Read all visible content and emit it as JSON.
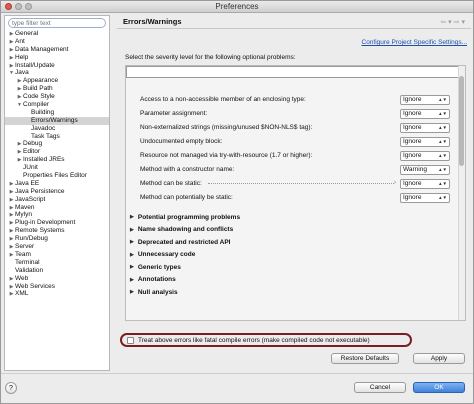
{
  "window": {
    "title": "Preferences"
  },
  "sidebar": {
    "filter_placeholder": "type filter text",
    "items": [
      {
        "label": "General",
        "twisty": "▶",
        "indent": 0
      },
      {
        "label": "Ant",
        "twisty": "▶",
        "indent": 0
      },
      {
        "label": "Data Management",
        "twisty": "▶",
        "indent": 0
      },
      {
        "label": "Help",
        "twisty": "▶",
        "indent": 0
      },
      {
        "label": "Install/Update",
        "twisty": "▶",
        "indent": 0
      },
      {
        "label": "Java",
        "twisty": "▼",
        "indent": 0
      },
      {
        "label": "Appearance",
        "twisty": "▶",
        "indent": 1
      },
      {
        "label": "Build Path",
        "twisty": "▶",
        "indent": 1
      },
      {
        "label": "Code Style",
        "twisty": "▶",
        "indent": 1
      },
      {
        "label": "Compiler",
        "twisty": "▼",
        "indent": 1
      },
      {
        "label": "Building",
        "twisty": "",
        "indent": 2
      },
      {
        "label": "Errors/Warnings",
        "twisty": "",
        "indent": 2,
        "selected": true
      },
      {
        "label": "Javadoc",
        "twisty": "",
        "indent": 2
      },
      {
        "label": "Task Tags",
        "twisty": "",
        "indent": 2
      },
      {
        "label": "Debug",
        "twisty": "▶",
        "indent": 1
      },
      {
        "label": "Editor",
        "twisty": "▶",
        "indent": 1
      },
      {
        "label": "Installed JREs",
        "twisty": "▶",
        "indent": 1
      },
      {
        "label": "JUnit",
        "twisty": "",
        "indent": 1
      },
      {
        "label": "Properties Files Editor",
        "twisty": "",
        "indent": 1
      },
      {
        "label": "Java EE",
        "twisty": "▶",
        "indent": 0
      },
      {
        "label": "Java Persistence",
        "twisty": "▶",
        "indent": 0
      },
      {
        "label": "JavaScript",
        "twisty": "▶",
        "indent": 0
      },
      {
        "label": "Maven",
        "twisty": "▶",
        "indent": 0
      },
      {
        "label": "Mylyn",
        "twisty": "▶",
        "indent": 0
      },
      {
        "label": "Plug-in Development",
        "twisty": "▶",
        "indent": 0
      },
      {
        "label": "Remote Systems",
        "twisty": "▶",
        "indent": 0
      },
      {
        "label": "Run/Debug",
        "twisty": "▶",
        "indent": 0
      },
      {
        "label": "Server",
        "twisty": "▶",
        "indent": 0
      },
      {
        "label": "Team",
        "twisty": "▶",
        "indent": 0
      },
      {
        "label": "Terminal",
        "twisty": "",
        "indent": 0
      },
      {
        "label": "Validation",
        "twisty": "",
        "indent": 0
      },
      {
        "label": "Web",
        "twisty": "▶",
        "indent": 0
      },
      {
        "label": "Web Services",
        "twisty": "▶",
        "indent": 0
      },
      {
        "label": "XML",
        "twisty": "▶",
        "indent": 0
      }
    ]
  },
  "panel": {
    "title": "Errors/Warnings",
    "nav_back": "⇦ ▾",
    "nav_fwd": "⇨ ▾",
    "configure_link": "Configure Project Specific Settings...",
    "description": "Select the severity level for the following optional problems:",
    "options": [
      {
        "label": "Access to a non-accessible member of an enclosing type:",
        "value": "Ignore",
        "dots": false
      },
      {
        "label": "Parameter assignment:",
        "value": "Ignore",
        "dots": false
      },
      {
        "label": "Non-externalized strings (missing/unused $NON-NLS$ tag):",
        "value": "Ignore",
        "dots": false
      },
      {
        "label": "Undocumented empty block:",
        "value": "Ignore",
        "dots": false
      },
      {
        "label": "Resource not managed via try-with-resource (1.7 or higher):",
        "value": "Ignore",
        "dots": false
      },
      {
        "label": "Method with a constructor name:",
        "value": "Warning",
        "dots": false
      },
      {
        "label": "Method can be static:",
        "value": "Ignore",
        "dots": true
      },
      {
        "label": "Method can potentially be static:",
        "value": "Ignore",
        "dots": false
      }
    ],
    "sections": [
      "Potential programming problems",
      "Name shadowing and conflicts",
      "Deprecated and restricted API",
      "Unnecessary code",
      "Generic types",
      "Annotations",
      "Null analysis"
    ],
    "treat_errors_label": "Treat above errors like fatal compile errors (make compiled code not executable)",
    "restore_defaults": "Restore Defaults",
    "apply": "Apply"
  },
  "footer": {
    "help": "?",
    "cancel": "Cancel",
    "ok": "OK"
  }
}
